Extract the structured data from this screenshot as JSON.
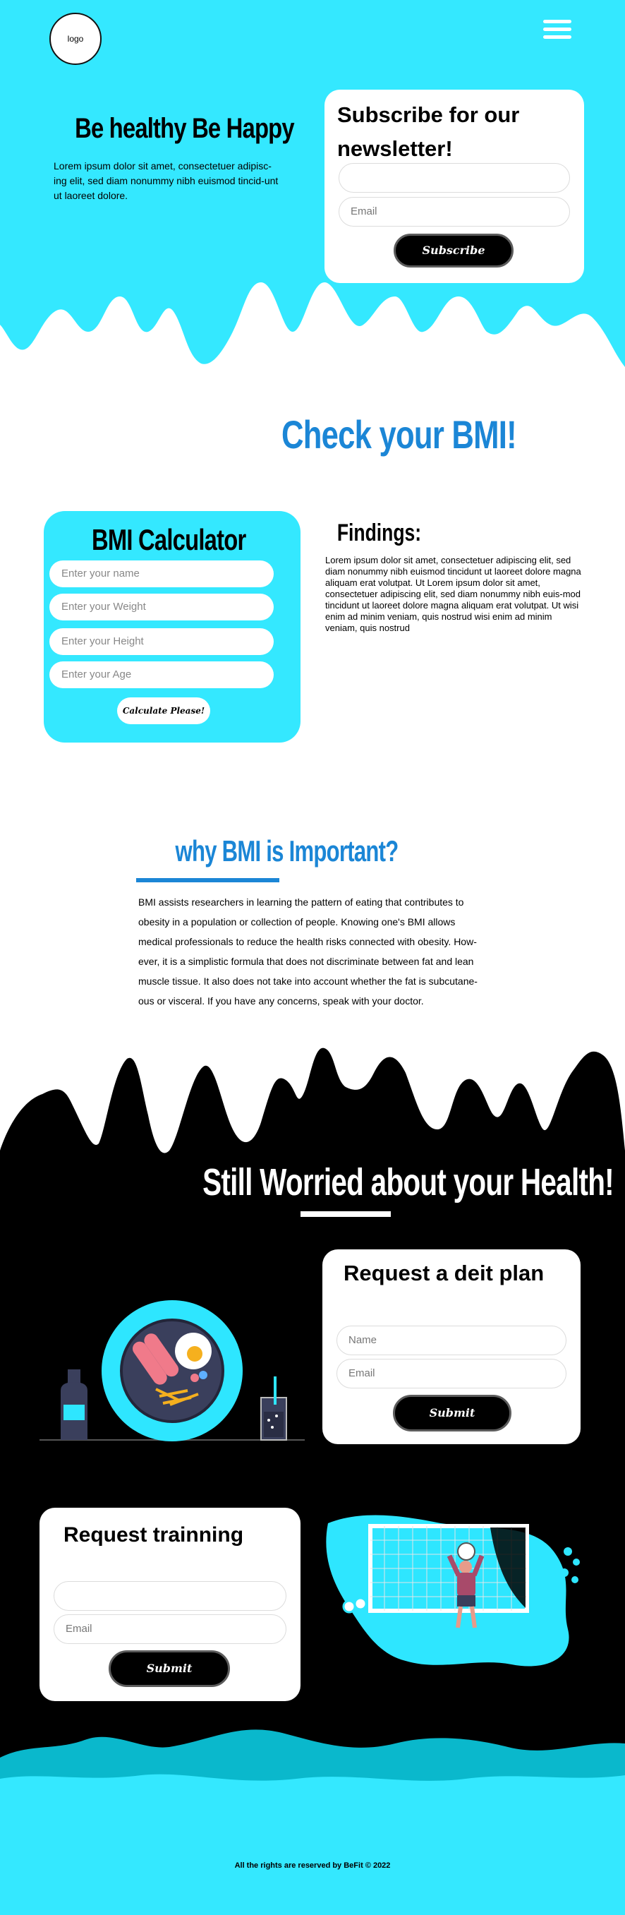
{
  "colors": {
    "primary": "#34e8ff",
    "heading_blue": "#1b86d6",
    "dark": "#000000"
  },
  "header": {
    "logo": "logo",
    "menu_icon": "hamburger-menu-icon"
  },
  "hero": {
    "title": "Be healthy Be Happy",
    "text": "Lorem ipsum dolor sit amet, consectetuer adipisc-ing elit, sed diam nonummy nibh euismod tincid-unt ut laoreet dolore."
  },
  "newsletter": {
    "title": "Subscribe for our newsletter!",
    "name_placeholder": "",
    "email_placeholder": "Email",
    "button": "Subscribe"
  },
  "bmi": {
    "heading": "Check your BMI!",
    "calculator_title": "BMI Calculator",
    "fields": [
      "Enter your name",
      "Enter your Weight",
      "Enter your Height",
      "Enter your Age"
    ],
    "button": "Calculate Please!",
    "findings_title": "Findings:",
    "findings_text": "Lorem ipsum dolor sit amet, consectetuer adipiscing elit, sed diam nonummy nibh euismod tincidunt ut laoreet dolore magna aliquam erat volutpat. Ut Lorem ipsum dolor sit amet, consectetuer adipiscing elit, sed diam nonummy nibh euis-mod tincidunt ut laoreet dolore magna aliquam erat volutpat. Ut wisi enim ad minim veniam, quis nostrud wisi enim ad minim veniam, quis nostrud"
  },
  "why": {
    "title": "why BMI is Important?",
    "text": "BMI assists researchers in learning the pattern of eating that contributes to obesity in a population or collection of people. Knowing one's BMI allows medical professionals to reduce the health risks connected with obesity. How-ever, it is a simplistic formula that does not discriminate between fat and lean muscle tissue. It also does not take into account whether the fat is subcutane-ous or visceral. If you have any concerns, speak with your doctor."
  },
  "worried": {
    "title": "Still Worried about your Health!"
  },
  "diet": {
    "title": "Request a deit plan",
    "name_placeholder": "Name",
    "email_placeholder": "Email",
    "button": "Submit"
  },
  "training": {
    "title": "Request trainning",
    "name_placeholder": "",
    "email_placeholder": "Email",
    "button": "Submit"
  },
  "footer": {
    "text": "All the rights are reserved by BeFit © 2022"
  }
}
